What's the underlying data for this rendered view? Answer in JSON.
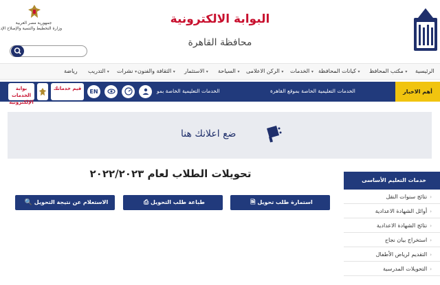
{
  "header": {
    "title": "البوابة الالكترونية",
    "subtitle": "محافظة القاهرة",
    "gov_line1": "جمهورية مصر العربية",
    "gov_line2": "وزارة التخطيط والتنمية والإصلاح الإداري",
    "search_placeholder": ""
  },
  "nav": {
    "items": [
      {
        "label": "رياضة"
      },
      {
        "label": "التدريب"
      },
      {
        "label": "نشرات"
      },
      {
        "label": "الثقافة والفنون"
      },
      {
        "label": "الاستثمار"
      },
      {
        "label": "السياحة"
      },
      {
        "label": "الركن الاعلامى"
      },
      {
        "label": "الخدمات"
      },
      {
        "label": "كيانات المحافظة"
      },
      {
        "label": "مكتب المحافظ"
      },
      {
        "label": "الرئيسية"
      }
    ]
  },
  "news": {
    "label": "أهم الاخبار",
    "item1": "الخدمات التعليمية الخاصة بموقع القاهرة",
    "item2": "الخدمات التعليمية الخاصة بمو",
    "en_label": "EN",
    "badge1": "قيم خدماتك",
    "badge2": "بوابة الخدمات الإلكترونية"
  },
  "ad": {
    "text": "ضع اعلانك هنا"
  },
  "main": {
    "title": "تحويلات الطلاب لعام ٢٠٢٢/٢٠٢٣",
    "buttons": [
      {
        "label": "استمارة طلب تحويل"
      },
      {
        "label": "طباعة طلب التحويل"
      },
      {
        "label": "الاستعلام عن نتيجة التحويل"
      }
    ]
  },
  "sidebar": {
    "heading": "خدمات التعليم الأساسى",
    "items": [
      {
        "label": "نتائج سنوات النقل"
      },
      {
        "label": "أوائل الشهادة الاعدادية"
      },
      {
        "label": "نتائج الشهادة الاعدادية"
      },
      {
        "label": "استخراج بيان نجاح"
      },
      {
        "label": "التقديم لرياض الأطفال"
      },
      {
        "label": "التحويلات المدرسية"
      }
    ]
  },
  "colors": {
    "primary": "#213a7c",
    "accent_red": "#c8102e",
    "news_label_bg": "#f1c40f",
    "ad_bg": "#e9ebf0"
  }
}
